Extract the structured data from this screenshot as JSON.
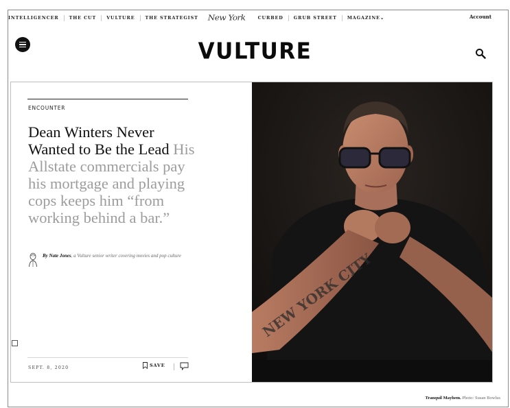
{
  "nav": {
    "links_left": [
      "INTELLIGENCER",
      "THE CUT",
      "VULTURE",
      "THE STRATEGIST"
    ],
    "logo": "New York",
    "links_right": [
      "CURBED",
      "GRUB STREET",
      "MAGAZINE"
    ],
    "magazine_caret": "⌄",
    "account": "Account"
  },
  "header": {
    "brand": "VULTURE",
    "menu_icon": "hamburger-icon",
    "search_icon": "search-icon"
  },
  "article": {
    "rubric": "ENCOUNTER",
    "title": "Dean Winters Never Wanted to Be the Lead",
    "dek": "His Allstate commercials pay his mortgage and playing cops keeps him “from working behind a bar.”",
    "author_prefix": "By",
    "author": "Nate Jones",
    "author_desc": ", a Vulture senior writer covering movies and pop culture",
    "date": "SEPT. 8, 2020",
    "save_label": "SAVE",
    "save_icon": "bookmark-icon",
    "comment_icon": "comment-icon"
  },
  "photo": {
    "caption_title": "Tranquil Mayhem.",
    "caption_credit": " Photo: Susan Bowlus",
    "tattoo_text": "NEW YORK CITY"
  }
}
